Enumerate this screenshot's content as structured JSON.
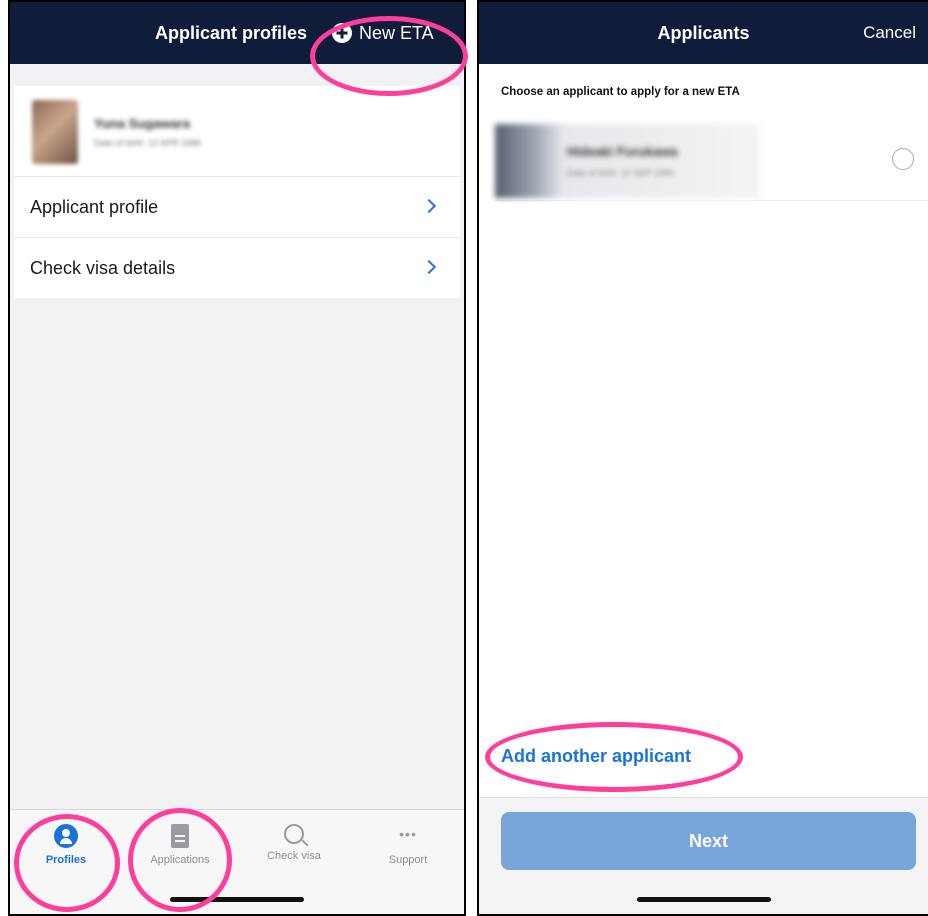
{
  "left_screen": {
    "header": {
      "title": "Applicant profiles",
      "action_label": "New ETA"
    },
    "profile": {
      "name": "Yuna Sugawara",
      "subtitle": "Date of birth: 12 APR 1986"
    },
    "menu": [
      {
        "label": "Applicant profile"
      },
      {
        "label": "Check visa details"
      }
    ],
    "tabs": [
      {
        "label": "Profiles",
        "icon": "person-circle-icon",
        "active": true
      },
      {
        "label": "Applications",
        "icon": "document-icon",
        "active": false
      },
      {
        "label": "Check visa",
        "icon": "search-icon",
        "active": false
      },
      {
        "label": "Support",
        "icon": "more-dots-icon",
        "active": false
      }
    ]
  },
  "right_screen": {
    "header": {
      "title": "Applicants",
      "cancel_label": "Cancel"
    },
    "instruction": "Choose an applicant to apply for a new ETA",
    "applicant": {
      "name": "Hideaki Furukawa",
      "subtitle": "Date of birth: 10 SEP 1984"
    },
    "add_applicant_label": "Add another applicant",
    "next_label": "Next"
  },
  "colors": {
    "header_bg": "#0f1d3a",
    "accent_blue": "#1a73d9",
    "next_button_bg": "#7aa5d8",
    "highlight_pink": "#ff3d9a"
  }
}
